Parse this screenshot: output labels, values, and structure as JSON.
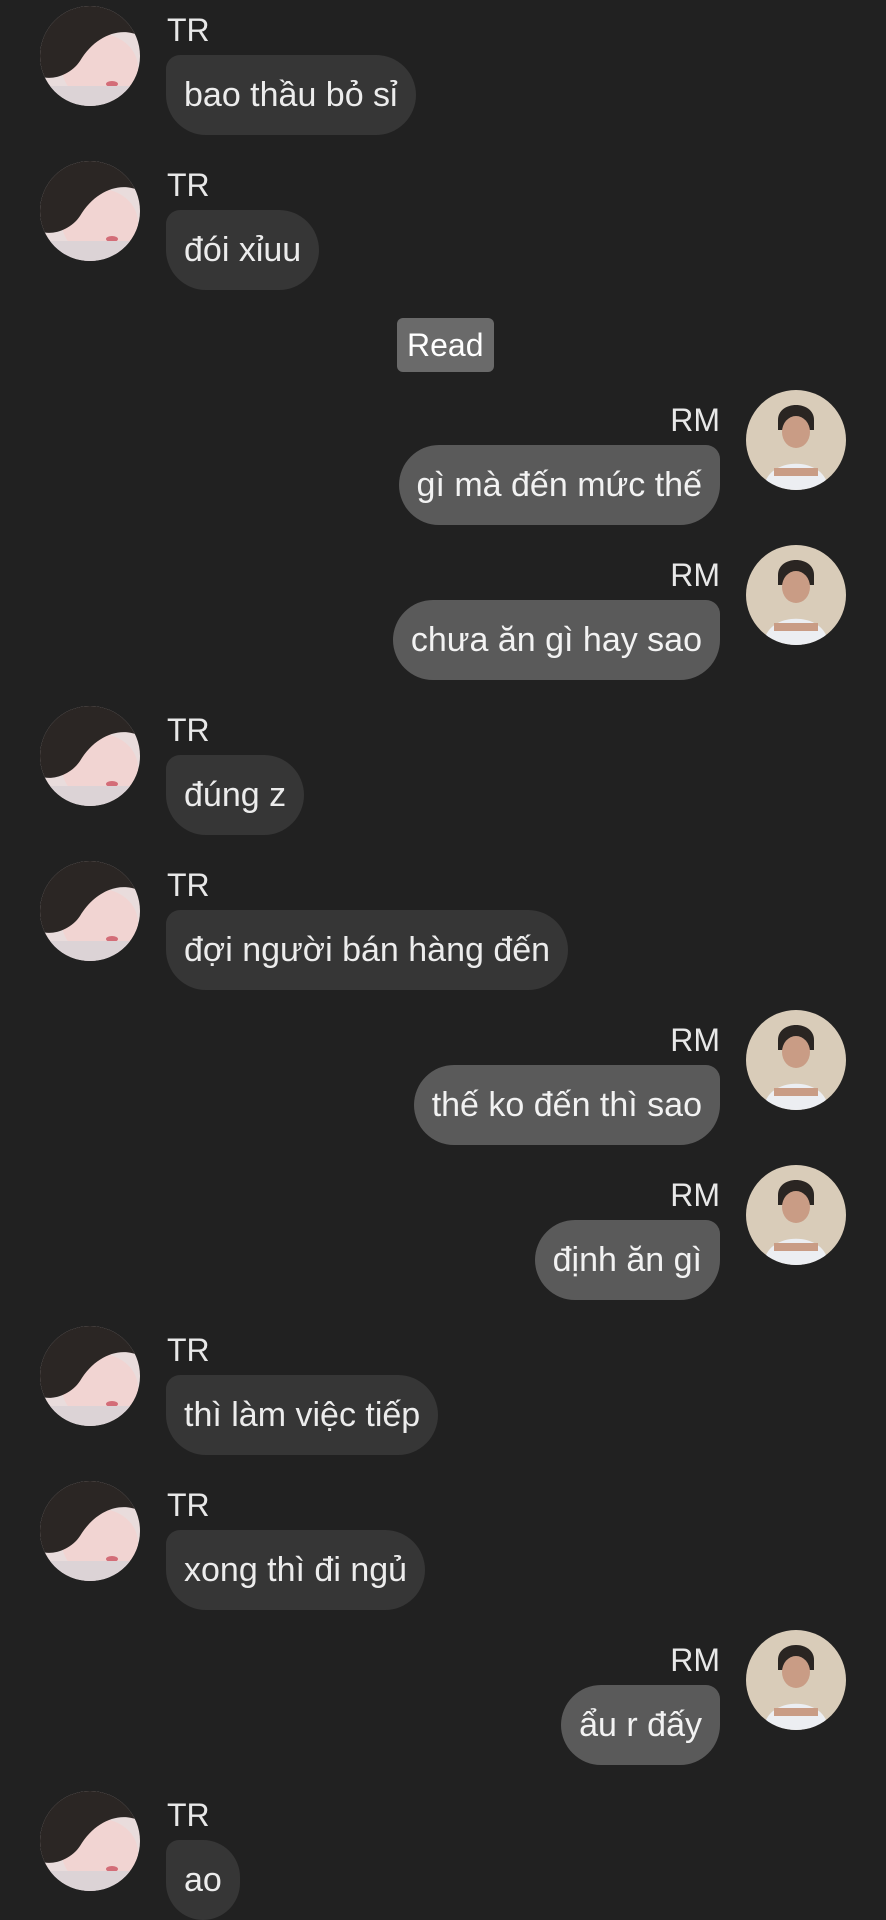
{
  "read_label": "Read",
  "messages": [
    {
      "dir": "in",
      "sender": "TR",
      "text": "bao thầu bỏ sỉ"
    },
    {
      "dir": "in",
      "sender": "TR",
      "text": "đói xỉuu"
    },
    {
      "dir": "out",
      "sender": "RM",
      "text": "gì mà đến mức thế"
    },
    {
      "dir": "out",
      "sender": "RM",
      "text": "chưa ăn gì hay sao"
    },
    {
      "dir": "in",
      "sender": "TR",
      "text": "đúng z"
    },
    {
      "dir": "in",
      "sender": "TR",
      "text": "đợi người bán hàng đến"
    },
    {
      "dir": "out",
      "sender": "RM",
      "text": "thế ko đến thì sao"
    },
    {
      "dir": "out",
      "sender": "RM",
      "text": "định ăn gì"
    },
    {
      "dir": "in",
      "sender": "TR",
      "text": "thì làm việc tiếp"
    },
    {
      "dir": "in",
      "sender": "TR",
      "text": "xong thì đi ngủ"
    },
    {
      "dir": "out",
      "sender": "RM",
      "text": "ẩu r đấy"
    },
    {
      "dir": "in",
      "sender": "TR",
      "text": "ao"
    }
  ]
}
